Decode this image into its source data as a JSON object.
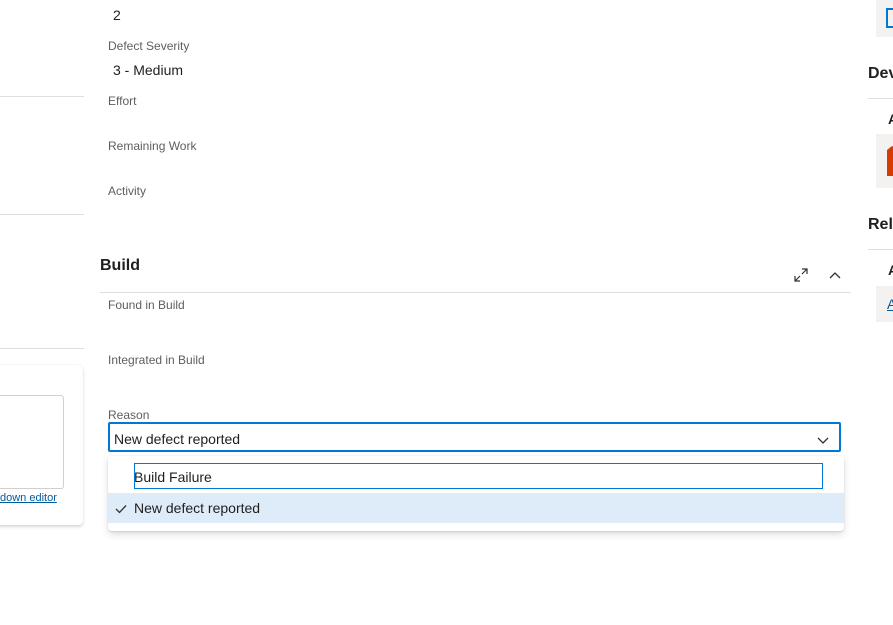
{
  "fields": {
    "top_value": "2",
    "defect_severity_label": "Defect Severity",
    "defect_severity_value": "3 - Medium",
    "effort_label": "Effort",
    "remaining_work_label": "Remaining Work",
    "activity_label": "Activity"
  },
  "build": {
    "title": "Build",
    "found_in_build_label": "Found in Build",
    "integrated_in_build_label": "Integrated in Build",
    "reason_label": "Reason",
    "reason_value": "New defect reported",
    "options": [
      {
        "label": "Build Failure"
      },
      {
        "label": "New defect reported"
      }
    ]
  },
  "left": {
    "markdown_link": "down editor"
  },
  "right": {
    "development_head": "Dev",
    "related_head": "Rela",
    "add_letter_1": "A",
    "add_letter_2": "A",
    "link_letter": "A"
  },
  "colors": {
    "accent": "#0078d4",
    "selected_bg": "#deecf9",
    "link": "#005a9e",
    "orange_icon": "#d83b01"
  }
}
